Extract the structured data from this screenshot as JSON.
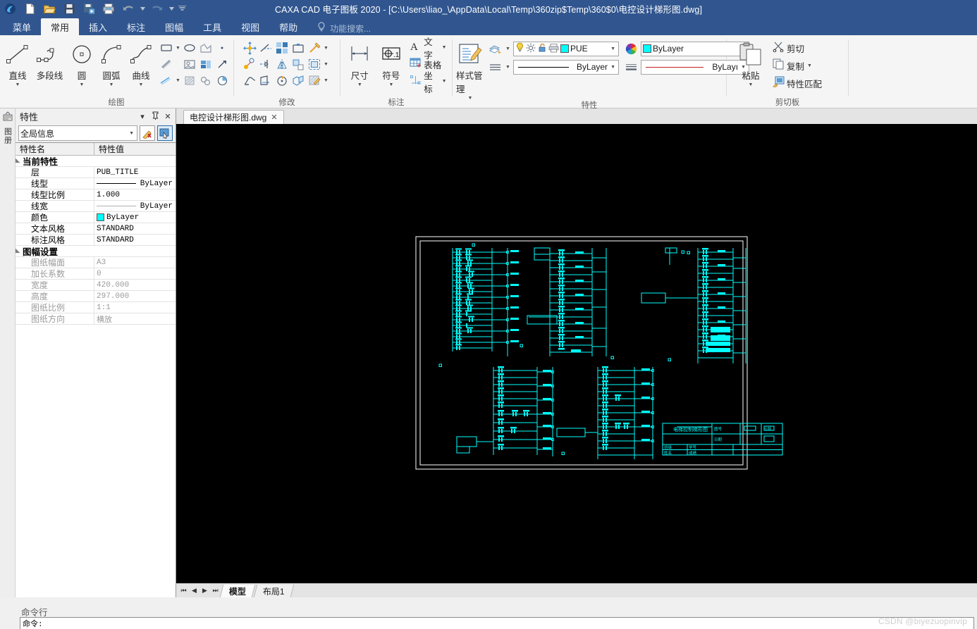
{
  "window": {
    "title": "CAXA CAD 电子图板 2020 - [C:\\Users\\liao_\\AppData\\Local\\Temp\\360zip$Temp\\360$0\\电控设计梯形图.dwg]",
    "quick_access": [
      {
        "name": "app-logo-icon",
        "label": "CAXA"
      },
      {
        "name": "new-file-icon",
        "label": "新建"
      },
      {
        "name": "open-file-icon",
        "label": "打开"
      },
      {
        "name": "save-icon",
        "label": "保存"
      },
      {
        "name": "save-as-icon",
        "label": "另存为"
      },
      {
        "name": "print-icon",
        "label": "打印"
      },
      {
        "name": "undo-icon",
        "label": "撤销"
      },
      {
        "name": "undo-dropdown-icon",
        "label": "▾"
      },
      {
        "name": "redo-icon",
        "label": "恢复"
      },
      {
        "name": "redo-dropdown-icon",
        "label": "▾"
      },
      {
        "name": "customize-qat-icon",
        "label": "▾"
      }
    ]
  },
  "ribbon": {
    "tabs": [
      {
        "label": "菜单",
        "active": false
      },
      {
        "label": "常用",
        "active": true
      },
      {
        "label": "插入",
        "active": false
      },
      {
        "label": "标注",
        "active": false
      },
      {
        "label": "图幅",
        "active": false
      },
      {
        "label": "工具",
        "active": false
      },
      {
        "label": "视图",
        "active": false
      },
      {
        "label": "帮助",
        "active": false
      }
    ],
    "search_placeholder": "功能搜索...",
    "panels": {
      "draw": {
        "title": "绘图",
        "big_buttons": [
          {
            "label": "直线",
            "icon": "line-icon",
            "has_arrow": true
          },
          {
            "label": "多段线",
            "icon": "polyline-icon",
            "has_arrow": false
          },
          {
            "label": "圆",
            "icon": "circle-icon",
            "has_arrow": true
          },
          {
            "label": "圆弧",
            "icon": "arc-icon",
            "has_arrow": true
          },
          {
            "label": "曲线",
            "icon": "spline-icon",
            "has_arrow": true
          }
        ],
        "small_buttons": [
          [
            "rectangle-icon",
            "ellipse-icon",
            "polygon-icon",
            "point-icon"
          ],
          [
            "hatch-fill-icon",
            "image-insert-icon",
            "block-create-icon",
            "arrow-icon"
          ],
          [
            "center-line-icon",
            "region-hatch-icon",
            "equation-curve-icon",
            "pie-fill-icon"
          ]
        ]
      },
      "modify": {
        "title": "修改",
        "small_buttons": [
          [
            "move-icon",
            "trim-icon",
            "array-icon",
            "break-icon",
            "chamfer-icon"
          ],
          [
            "copy-move-icon",
            "extend-icon",
            "mirror-icon",
            "fillet-icon",
            "offset-icon"
          ],
          [
            "stretch-icon",
            "scale-icon",
            "rotate-icon",
            "explode-icon",
            "edit-hatch-icon"
          ]
        ]
      },
      "annotate": {
        "title": "标注",
        "big_buttons": [
          {
            "label": "尺寸",
            "icon": "dimension-icon",
            "has_arrow": true
          },
          {
            "label": "符号",
            "icon": "symbol-icon",
            "has_arrow": true
          }
        ],
        "text_buttons": [
          {
            "label": "文字",
            "icon": "text-icon",
            "has_arrow": true
          },
          {
            "label": "表格",
            "icon": "table-icon",
            "has_arrow": false
          },
          {
            "label": "坐标",
            "icon": "coordinate-icon",
            "has_arrow": true
          }
        ]
      },
      "properties": {
        "title": "特性",
        "style_manager_label": "样式管理",
        "style_manager_icon": "style-manager-icon",
        "layer_tool_icon": "layer-tool-icon",
        "linetype_tool_icon": "linetype-tool-icon",
        "color_wheel_icon": "color-wheel-icon",
        "lineweight_tool_icon": "lineweight-tool-icon",
        "layer_state_icons": [
          "lightbulb-icon",
          "sun-freeze-icon",
          "lock-icon",
          "plot-icon"
        ],
        "layer_value": "PUE",
        "layer_color": "#00ffff",
        "color_value": "ByLayer",
        "color_swatch": "#00ffff",
        "linetype_value": "ByLayer",
        "lineweight_value": "ByLayı"
      },
      "clipboard": {
        "title": "剪切板",
        "paste_label": "粘贴",
        "paste_icon": "paste-icon",
        "items": [
          {
            "label": "剪切",
            "icon": "cut-scissors-icon",
            "has_arrow": false
          },
          {
            "label": "复制",
            "icon": "copy-icon",
            "has_arrow": true
          },
          {
            "label": "特性匹配",
            "icon": "match-properties-icon",
            "has_arrow": false
          }
        ]
      }
    }
  },
  "dock_strip": {
    "icon": "properties-dock-icon",
    "label": "图册"
  },
  "properties_palette": {
    "title": "特性",
    "header_buttons": [
      {
        "name": "collapse-icon",
        "label": "▾"
      },
      {
        "name": "pin-icon",
        "label": "⚲"
      },
      {
        "name": "close-icon",
        "label": "✕"
      }
    ],
    "scope_value": "全局信息",
    "tool_buttons": [
      {
        "name": "clear-selection-icon"
      },
      {
        "name": "pick-object-icon"
      }
    ],
    "columns": [
      "特性名",
      "特性值"
    ],
    "groups": [
      {
        "label": "当前特性",
        "rows": [
          {
            "name": "层",
            "value": "PUB_TITLE",
            "kind": "text",
            "dim": false
          },
          {
            "name": "线型",
            "value": "ByLayer",
            "kind": "linetype",
            "dim": false
          },
          {
            "name": "线型比例",
            "value": "1.000",
            "kind": "text",
            "dim": false
          },
          {
            "name": "线宽",
            "value": "ByLayer",
            "kind": "lineweight",
            "dim": false
          },
          {
            "name": "颜色",
            "value": "ByLayer",
            "kind": "color",
            "swatch": "#00ffff",
            "dim": false
          },
          {
            "name": "文本风格",
            "value": "STANDARD",
            "kind": "text",
            "dim": false
          },
          {
            "name": "标注风格",
            "value": "STANDARD",
            "kind": "text",
            "dim": false
          }
        ]
      },
      {
        "label": "图幅设置",
        "rows": [
          {
            "name": "图纸幅面",
            "value": "A3",
            "kind": "text",
            "dim": true
          },
          {
            "name": "加长系数",
            "value": "0",
            "kind": "text",
            "dim": true
          },
          {
            "name": "宽度",
            "value": "420.000",
            "kind": "text",
            "dim": true
          },
          {
            "name": "高度",
            "value": "297.000",
            "kind": "text",
            "dim": true
          },
          {
            "name": "图纸比例",
            "value": "1:1",
            "kind": "text",
            "dim": true
          },
          {
            "name": "图纸方向",
            "value": "横放",
            "kind": "text",
            "dim": true
          }
        ]
      }
    ]
  },
  "document": {
    "tab_label": "电控设计梯形图.dwg",
    "close_label": "✕"
  },
  "canvas": {
    "background": "#000000",
    "drawing_color": "#00ffff",
    "frame_color": "#ffffff",
    "title_block": {
      "drawing_title": "电梯控制梯形图",
      "fields": [
        {
          "label": "图号",
          "value": ""
        },
        {
          "label": "比例",
          "value": ""
        },
        {
          "label": "日期",
          "value": ""
        },
        {
          "label": "班级",
          "value": ""
        },
        {
          "label": "学号",
          "value": ""
        },
        {
          "label": "姓名",
          "value": ""
        },
        {
          "label": "成绩",
          "value": ""
        }
      ]
    }
  },
  "model_tabs": {
    "nav_buttons": [
      "first-sheet-icon",
      "prev-sheet-icon",
      "next-sheet-icon",
      "last-sheet-icon"
    ],
    "tabs": [
      {
        "label": "模型",
        "active": true
      },
      {
        "label": "布局1",
        "active": false
      }
    ]
  },
  "command_bar": {
    "label": "命令行",
    "prompt": "命令:"
  },
  "watermark": "CSDN @biyezuopinvip",
  "theme": {
    "titlebar": "#31568f",
    "ribbon_bg": "#f5f5f5",
    "accent": "#2d6ca8",
    "cad_cyan": "#00ffff"
  }
}
